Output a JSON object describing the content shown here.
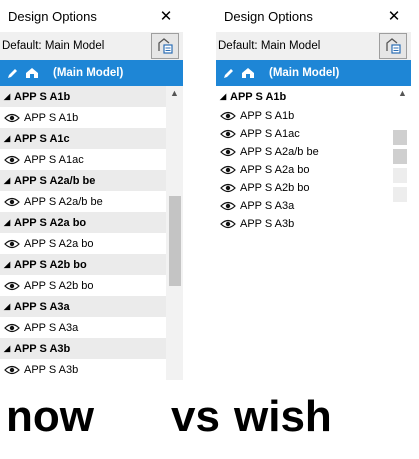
{
  "now": {
    "title": "Design Options",
    "default_label": "Default: Main Model",
    "main_model_label": "(Main Model)",
    "groups": [
      {
        "name": "APP S A1b",
        "item": "APP S A1b"
      },
      {
        "name": "APP S A1c",
        "item": "APP S A1ac"
      },
      {
        "name": "APP S A2a/b be",
        "item": "APP S A2a/b be"
      },
      {
        "name": "APP S A2a bo",
        "item": "APP S A2a bo"
      },
      {
        "name": "APP S A2b bo",
        "item": "APP S A2b bo"
      },
      {
        "name": "APP S A3a",
        "item": "APP S A3a"
      },
      {
        "name": "APP S A3b",
        "item": "APP S A3b"
      }
    ]
  },
  "wish": {
    "title": "Design Options",
    "default_label": "Default: Main Model",
    "main_model_label": "(Main Model)",
    "group_name": "APP S A1b",
    "items": [
      "APP S A1b",
      "APP S A1ac",
      "APP S A2a/b be",
      "APP S A2a bo",
      "APP S A2b bo",
      "APP S A3a",
      "APP S A3b"
    ]
  },
  "caption": {
    "now": "now",
    "vs": "vs",
    "wish": "wish"
  },
  "colors": {
    "accent": "#1e86d6",
    "group_bg": "#ebebeb"
  }
}
